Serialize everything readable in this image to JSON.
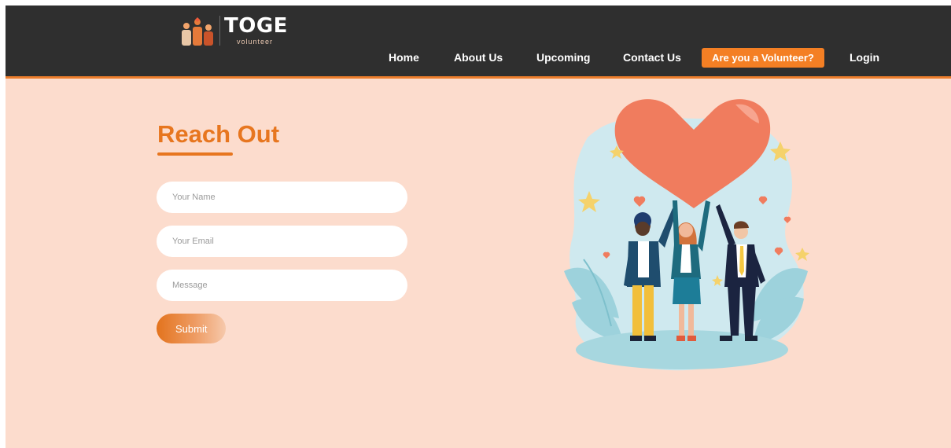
{
  "brand": {
    "name": "TOGE",
    "tagline": "volunteer"
  },
  "nav": {
    "items": [
      {
        "id": "home",
        "label": "Home"
      },
      {
        "id": "about-us",
        "label": "About Us"
      },
      {
        "id": "upcoming",
        "label": "Upcoming"
      },
      {
        "id": "contact-us",
        "label": "Contact Us"
      }
    ],
    "cta_label": "Are you a Volunteer?",
    "login_label": "Login"
  },
  "contact": {
    "title": "Reach Out",
    "name_placeholder": "Your Name",
    "email_placeholder": "Your Email",
    "message_placeholder": "Message",
    "submit_label": "Submit"
  },
  "colors": {
    "navbar": "#2f2f2f",
    "accent": "#e7761f",
    "page_background": "#fcdccd",
    "cta": "#f47f24"
  }
}
